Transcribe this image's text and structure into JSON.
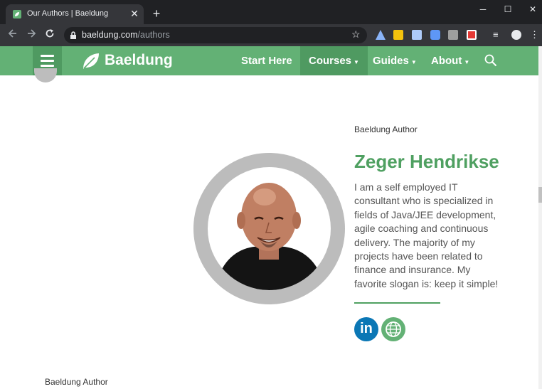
{
  "browser": {
    "tab_title": "Our Authors | Baeldung",
    "tab_close": "✕",
    "new_tab": "+",
    "url_host": "baeldung.com",
    "url_path": "/authors",
    "window_controls": {
      "minimize": "─",
      "maximize": "☐",
      "close": "✕"
    }
  },
  "site_nav": {
    "logo": "Baeldung",
    "items": [
      {
        "label": "Start Here",
        "dropdown": false
      },
      {
        "label": "Courses",
        "dropdown": true,
        "active": true
      },
      {
        "label": "Guides",
        "dropdown": true
      },
      {
        "label": "About",
        "dropdown": true
      }
    ],
    "caret": "▼"
  },
  "author": {
    "label": "Baeldung Author",
    "name": "Zeger Hendrikse",
    "bio_lines": [
      "I am a self employed IT",
      "consultant who is specialized in",
      "fields of Java/JEE development,",
      "agile coaching and continuous",
      "delivery. The majority of my",
      "projects have been related to",
      "finance and insurance. My",
      "favorite slogan is: keep it simple!"
    ],
    "linkedin_text": "in"
  },
  "next_author": {
    "label": "Baeldung Author"
  },
  "colors": {
    "brand_green": "#63b175",
    "name_green": "#4fa061",
    "linkedin_blue": "#0b77b5"
  },
  "icons": [
    "leaf-icon",
    "lock-icon",
    "star-icon",
    "search-icon",
    "linkedin-icon",
    "website-icon",
    "hamburger-icon"
  ]
}
